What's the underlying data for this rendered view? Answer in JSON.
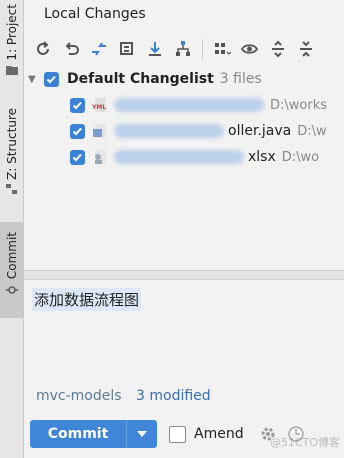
{
  "sidebar": {
    "tabs": [
      {
        "label": "1: Project",
        "active": false
      },
      {
        "label": "Z: Structure",
        "active": false
      },
      {
        "label": "Commit",
        "active": true
      }
    ]
  },
  "header": {
    "title": "Local Changes"
  },
  "toolbar": {
    "icons": [
      "refresh-icon",
      "rollback-icon",
      "show-diff-icon",
      "shelve-icon",
      "update-icon",
      "group-by-icon",
      "expand-icon",
      "view-options-icon",
      "collapse-icon"
    ]
  },
  "changelist": {
    "name": "Default Changelist",
    "count": "3 files",
    "files": [
      {
        "icon": "yaml-icon",
        "name": "",
        "path": "D:\\works"
      },
      {
        "icon": "java-class-icon",
        "name": "oller.java",
        "path": "D:\\w"
      },
      {
        "icon": "excel-file-icon",
        "name": "xlsx",
        "path": "D:\\wo"
      }
    ]
  },
  "commit_message": "添加数据流程图",
  "status": {
    "branch": "mvc-models",
    "modified": "3 modified"
  },
  "commit_bar": {
    "commit_label": "Commit",
    "amend_label": "Amend",
    "amend_checked": false
  },
  "watermark": "@51CTO博客",
  "colors": {
    "accent": "#3f86d8",
    "checkbox": "#3b82d6"
  }
}
